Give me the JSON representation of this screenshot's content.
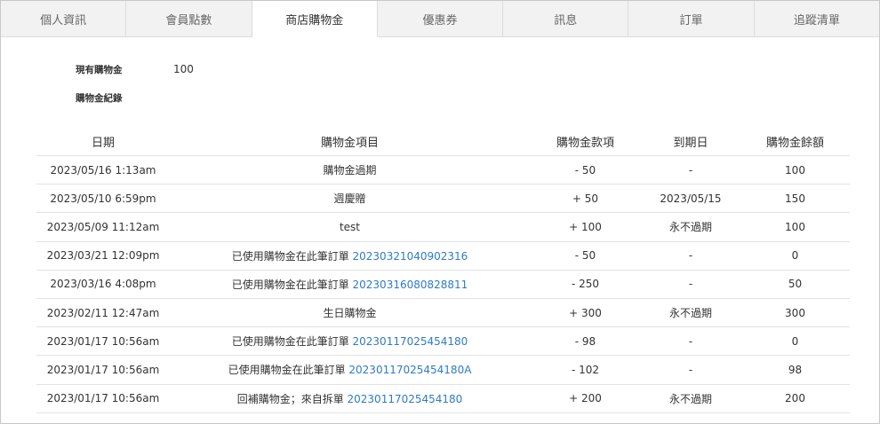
{
  "tabs": [
    {
      "label": "個人資訊",
      "active": false
    },
    {
      "label": "會員點數",
      "active": false
    },
    {
      "label": "商店購物金",
      "active": true
    },
    {
      "label": "優惠券",
      "active": false
    },
    {
      "label": "訊息",
      "active": false
    },
    {
      "label": "訂單",
      "active": false
    },
    {
      "label": "追蹤清單",
      "active": false
    }
  ],
  "summary": {
    "current_label": "現有購物金",
    "current_value": "100",
    "history_label": "購物金紀錄"
  },
  "table": {
    "headers": {
      "date": "日期",
      "item": "購物金項目",
      "amount": "購物金款項",
      "expiry": "到期日",
      "balance": "購物金餘額"
    },
    "rows": [
      {
        "date": "2023/05/16 1:13am",
        "item_prefix": "購物金過期",
        "order": "",
        "amount": "- 50",
        "expiry": "-",
        "balance": "100"
      },
      {
        "date": "2023/05/10 6:59pm",
        "item_prefix": "週慶贈",
        "order": "",
        "amount": "+ 50",
        "expiry": "2023/05/15",
        "balance": "150"
      },
      {
        "date": "2023/05/09 11:12am",
        "item_prefix": "test",
        "order": "",
        "amount": "+ 100",
        "expiry": "永不過期",
        "balance": "100"
      },
      {
        "date": "2023/03/21 12:09pm",
        "item_prefix": "已使用購物金在此筆訂單 ",
        "order": "20230321040902316",
        "amount": "- 50",
        "expiry": "-",
        "balance": "0"
      },
      {
        "date": "2023/03/16 4:08pm",
        "item_prefix": "已使用購物金在此筆訂單 ",
        "order": "20230316080828811",
        "amount": "- 250",
        "expiry": "-",
        "balance": "50"
      },
      {
        "date": "2023/02/11 12:47am",
        "item_prefix": "生日購物金",
        "order": "",
        "amount": "+ 300",
        "expiry": "永不過期",
        "balance": "300"
      },
      {
        "date": "2023/01/17 10:56am",
        "item_prefix": "已使用購物金在此筆訂單 ",
        "order": "20230117025454180",
        "amount": "- 98",
        "expiry": "-",
        "balance": "0"
      },
      {
        "date": "2023/01/17 10:56am",
        "item_prefix": "已使用購物金在此筆訂單 ",
        "order": "20230117025454180A",
        "amount": "- 102",
        "expiry": "-",
        "balance": "98"
      },
      {
        "date": "2023/01/17 10:56am",
        "item_prefix": "回補購物金；來自拆單 ",
        "order": "20230117025454180",
        "amount": "+ 200",
        "expiry": "永不過期",
        "balance": "200"
      }
    ]
  },
  "colors": {
    "link": "#2e7bc7",
    "tab_bg": "#f2f2f2",
    "active_tab_bg": "#ffffff"
  }
}
